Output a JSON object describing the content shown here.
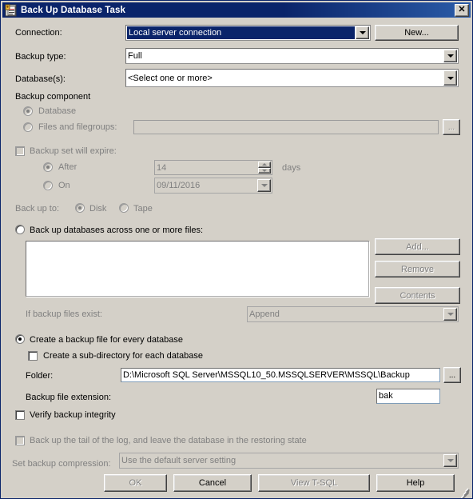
{
  "window": {
    "title": "Back Up Database Task",
    "icon": "task-properties-icon",
    "close_label": "✕"
  },
  "form": {
    "connection_label": "Connection:",
    "connection_value": "Local server connection",
    "new_button": "New...",
    "backup_type_label": "Backup type:",
    "backup_type_value": "Full",
    "databases_label": "Database(s):",
    "databases_value": "<Select one or more>",
    "backup_component_label": "Backup component",
    "component_database": "Database",
    "component_files_filegroups": "Files and filegroups:",
    "files_filegroups_value": "",
    "files_browse_button": "...",
    "expire_label": "Backup set will expire:",
    "expire_after_label": "After",
    "expire_after_value": "14",
    "expire_days_label": "days",
    "expire_on_label": "On",
    "expire_on_value": "09/11/2016",
    "back_up_to_label": "Back up to:",
    "back_up_to_disk": "Disk",
    "back_up_to_tape": "Tape",
    "across_files_label": "Back up databases across one or more files:",
    "add_button": "Add...",
    "remove_button": "Remove",
    "contents_button": "Contents",
    "if_exist_label": "If backup files exist:",
    "if_exist_value": "Append",
    "create_file_per_db_label": "Create a backup file for every database",
    "create_subdir_label": "Create a sub-directory for each database",
    "folder_label": "Folder:",
    "folder_value": "D:\\Microsoft SQL Server\\MSSQL10_50.MSSQLSERVER\\MSSQL\\Backup",
    "folder_browse_button": "...",
    "extension_label": "Backup file extension:",
    "extension_value": "bak",
    "verify_integrity_label": "Verify backup integrity",
    "tail_log_label": "Back up the tail of the log, and leave the database in the restoring state",
    "compression_label": "Set backup compression:",
    "compression_value": "Use the default server setting"
  },
  "footer": {
    "ok_button": "OK",
    "cancel_button": "Cancel",
    "view_tsql_button": "View T-SQL",
    "help_button": "Help"
  },
  "colors": {
    "titlebar": "#0a246a",
    "dialog_face": "#d4d0c8",
    "highlight": "#0a246a",
    "disabled_text": "#808080"
  }
}
